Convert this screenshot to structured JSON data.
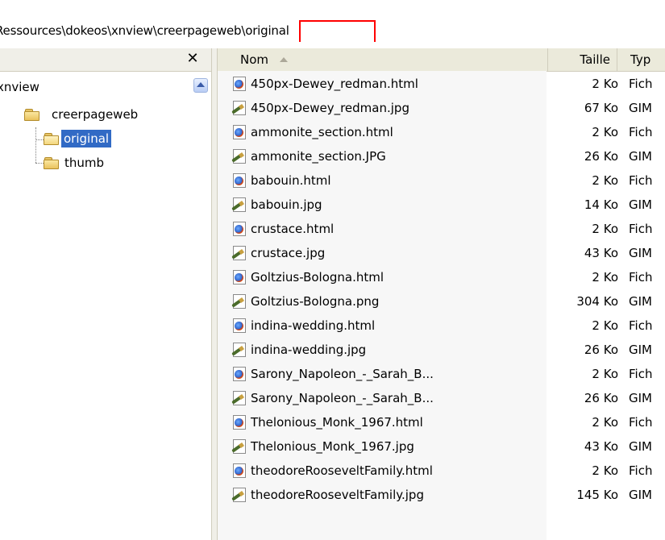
{
  "address_bar": {
    "path": "Ressources\\dokeos\\xnview\\creerpageweb\\original"
  },
  "folders_pane": {
    "close_symbol": "✕",
    "tree": [
      {
        "label": "xnview"
      },
      {
        "label": "creerpageweb"
      },
      {
        "label": "original",
        "selected": true
      },
      {
        "label": "thumb"
      }
    ]
  },
  "file_list": {
    "columns": {
      "name": "Nom",
      "size": "Taille",
      "type": "Typ"
    },
    "files": [
      {
        "name": "450px-Dewey_redman.html",
        "size": "2 Ko",
        "type": "Fich",
        "icon": "html-file-icon"
      },
      {
        "name": "450px-Dewey_redman.jpg",
        "size": "67 Ko",
        "type": "GIM",
        "icon": "image-file-icon"
      },
      {
        "name": "ammonite_section.html",
        "size": "2 Ko",
        "type": "Fich",
        "icon": "html-file-icon"
      },
      {
        "name": "ammonite_section.JPG",
        "size": "26 Ko",
        "type": "GIM",
        "icon": "image-file-icon"
      },
      {
        "name": "babouin.html",
        "size": "2 Ko",
        "type": "Fich",
        "icon": "html-file-icon"
      },
      {
        "name": "babouin.jpg",
        "size": "14 Ko",
        "type": "GIM",
        "icon": "image-file-icon"
      },
      {
        "name": "crustace.html",
        "size": "2 Ko",
        "type": "Fich",
        "icon": "html-file-icon"
      },
      {
        "name": "crustace.jpg",
        "size": "43 Ko",
        "type": "GIM",
        "icon": "image-file-icon"
      },
      {
        "name": "Goltzius-Bologna.html",
        "size": "2 Ko",
        "type": "Fich",
        "icon": "html-file-icon"
      },
      {
        "name": "Goltzius-Bologna.png",
        "size": "304 Ko",
        "type": "GIM",
        "icon": "image-file-icon"
      },
      {
        "name": "indina-wedding.html",
        "size": "2 Ko",
        "type": "Fich",
        "icon": "html-file-icon"
      },
      {
        "name": "indina-wedding.jpg",
        "size": "26 Ko",
        "type": "GIM",
        "icon": "image-file-icon"
      },
      {
        "name": "Sarony_Napoleon_-_Sarah_B...",
        "size": "2 Ko",
        "type": "Fich",
        "icon": "html-file-icon"
      },
      {
        "name": "Sarony_Napoleon_-_Sarah_B...",
        "size": "26 Ko",
        "type": "GIM",
        "icon": "image-file-icon"
      },
      {
        "name": "Thelonious_Monk_1967.html",
        "size": "2 Ko",
        "type": "Fich",
        "icon": "html-file-icon"
      },
      {
        "name": "Thelonious_Monk_1967.jpg",
        "size": "43 Ko",
        "type": "GIM",
        "icon": "image-file-icon"
      },
      {
        "name": "theodoreRooseveltFamily.html",
        "size": "2 Ko",
        "type": "Fich",
        "icon": "html-file-icon"
      },
      {
        "name": "theodoreRooseveltFamily.jpg",
        "size": "145 Ko",
        "type": "GIM",
        "icon": "image-file-icon"
      }
    ]
  },
  "colors": {
    "selection": "#316ac5",
    "highlight_box": "#ff0000",
    "header_bg": "#ebeadb"
  }
}
